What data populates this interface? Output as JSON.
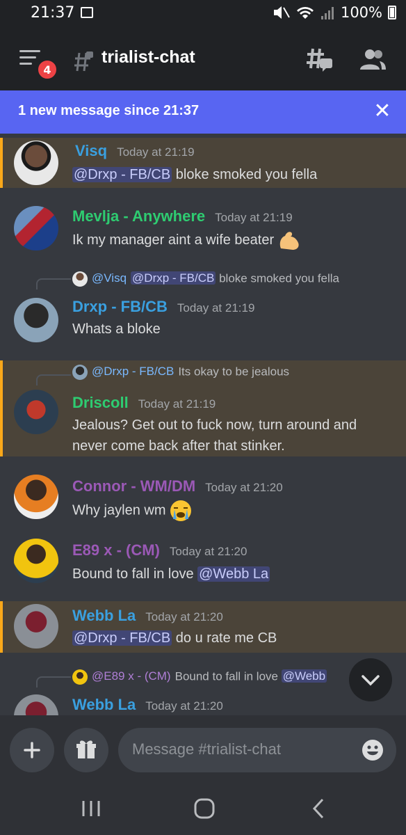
{
  "status_bar": {
    "time": "21:37",
    "battery": "100%"
  },
  "header": {
    "channel_name": "trialist-chat",
    "badge_count": "4"
  },
  "banner": {
    "text": "1 new message since 21:37",
    "close": "✕"
  },
  "messages": [
    {
      "user": "Visq",
      "time": "Today at 21:19",
      "mention": "@Drxp - FB/CB",
      "text": " bloke smoked you fella"
    },
    {
      "user": "Mevlja - Anywhere",
      "time": "Today at 21:19",
      "text": "Ik my manager aint a wife beater"
    },
    {
      "reply_user": "@Visq",
      "reply_mention": "@Drxp - FB/CB",
      "reply_text": " bloke smoked you fella",
      "user": "Drxp - FB/CB",
      "time": "Today at 21:19",
      "text": "Whats a bloke"
    },
    {
      "reply_user": "@Drxp - FB/CB",
      "reply_text": "Its okay to be jealous",
      "user": "Driscoll",
      "time": "Today at 21:19",
      "text_line1": "Jealous? Get out to fuck now, turn around and",
      "text_line2": "never come back after that stinker."
    },
    {
      "user": "Connor - WM/DM",
      "time": "Today at 21:20",
      "text": "Why jaylen wm"
    },
    {
      "user": "E89 x - (CM)",
      "time": "Today at 21:20",
      "text": "Bound to fall in love ",
      "mention": "@Webb La"
    },
    {
      "user": "Webb La",
      "time": "Today at 21:20",
      "mention": "@Drxp - FB/CB",
      "text": " do u rate me CB"
    },
    {
      "reply_user": "@E89 x - (CM)",
      "reply_text": "Bound to fall in love ",
      "reply_mention": "@Webb",
      "user": "Webb La",
      "time": "Today at 21:20"
    }
  ],
  "composer": {
    "placeholder": "Message #trialist-chat"
  },
  "colors": {
    "blurple": "#5865f2",
    "mention_bg": "#4b4439",
    "mention_bar": "#faa81a",
    "blue_name": "#3aa0e0",
    "green_name": "#2ecc71",
    "purple_name": "#9b59b6"
  }
}
